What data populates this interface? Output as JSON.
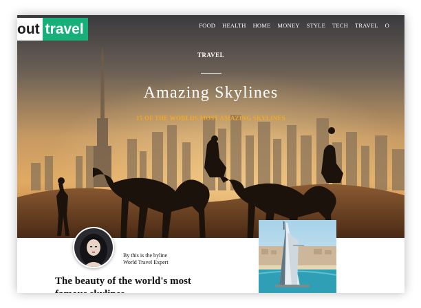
{
  "logo": {
    "part1": "out",
    "part2": "travel"
  },
  "nav": {
    "items": [
      "FOOD",
      "HEALTH",
      "HOME",
      "MONEY",
      "STYLE",
      "TECH",
      "TRAVEL",
      "O"
    ]
  },
  "hero": {
    "kicker": "TRAVEL",
    "title": "Amazing Skylines",
    "subtitle": "15 OF THE WORLDS MOST AMAZING SKYLINES"
  },
  "author": {
    "byline": "By this is the byline",
    "role": "World Travel Expert"
  },
  "article": {
    "lead": "The beauty of the world's most famous skylines"
  },
  "colors": {
    "brand": "#18b07a",
    "accent": "#f0a928"
  },
  "icons": {
    "avatar": "author-avatar-image",
    "hero": "desert-camel-skyline-image",
    "inline": "burj-al-arab-image"
  }
}
